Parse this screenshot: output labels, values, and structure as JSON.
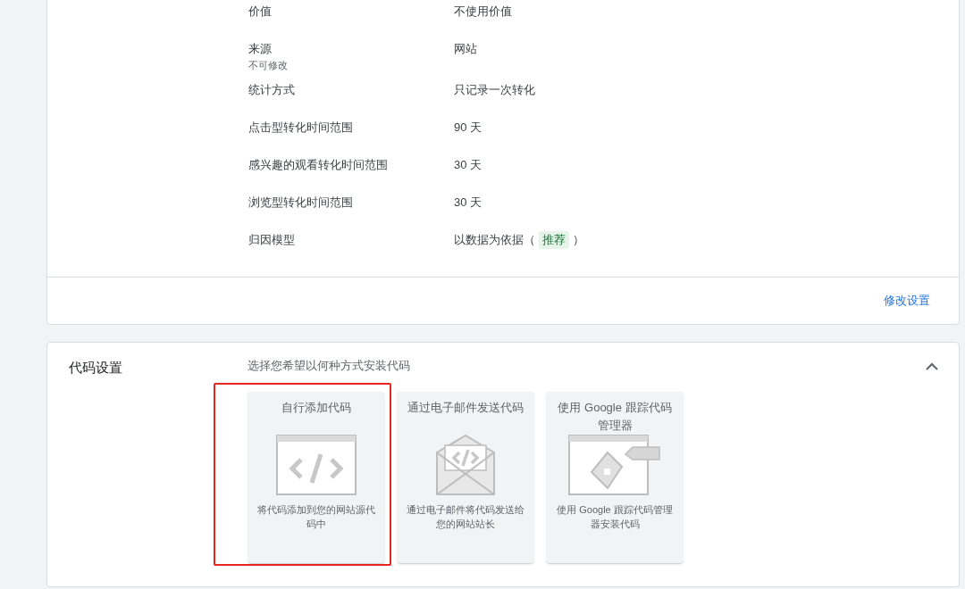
{
  "conversion_settings": {
    "rows": [
      {
        "label": "价值",
        "value": "不使用价值"
      },
      {
        "label": "来源",
        "note": "不可修改",
        "value": "网站"
      },
      {
        "label": "统计方式",
        "value": "只记录一次转化"
      },
      {
        "label": "点击型转化时间范围",
        "value": "90 天"
      },
      {
        "label": "感兴趣的观看转化时间范围",
        "value": "30 天"
      },
      {
        "label": "浏览型转化时间范围",
        "value": "30 天"
      },
      {
        "label": "归因模型",
        "value": "以数据为依据（",
        "badge": "推荐",
        "value_end": "）"
      }
    ],
    "edit_link": "修改设置"
  },
  "code_settings": {
    "title": "代码设置",
    "subtitle": "选择您希望以何种方式安装代码",
    "expanded": true,
    "options": [
      {
        "kind": "manual",
        "title": "自行添加代码",
        "description": "将代码添加到您的网站源代码中",
        "highlighted": true
      },
      {
        "kind": "email",
        "title": "通过电子邮件发送代码",
        "description": "通过电子邮件将代码发送给您的网站站长",
        "highlighted": false
      },
      {
        "kind": "tag_manager",
        "title": "使用 Google 跟踪代码管理器",
        "description": "使用 Google 跟踪代码管理器安装代码",
        "highlighted": false
      }
    ]
  }
}
